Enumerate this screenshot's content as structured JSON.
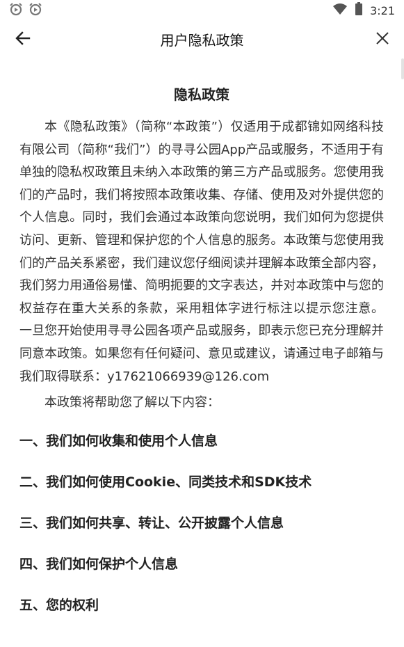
{
  "status_bar": {
    "time": "3:21",
    "icons": [
      "alarm-icon",
      "alarm-icon",
      "wifi-icon",
      "battery-icon"
    ]
  },
  "app_bar": {
    "title": "用户隐私政策",
    "back_icon": "arrow-left-icon",
    "close_icon": "close-icon"
  },
  "document": {
    "title": "隐私政策",
    "paragraph": "本《隐私政策》（简称“本政策”）仅适用于成都锦如网络科技有限公司（简称“我们”）的寻寻公园App产品或服务，不适用于有单独的隐私权政策且未纳入本政策的第三方产品或服务。您使用我们的产品时，我们将按照本政策收集、存储、使用及对外提供您的个人信息。同时，我们会通过本政策向您说明，我们如何为您提供访问、更新、管理和保护您的个人信息的服务。本政策与您使用我们的产品关系紧密，我们建议您仔细阅读并理解本政策全部内容，我们努力用通俗易懂、简明扼要的文字表达，并对本政策中与您的权益存在重大关系的条款，采用粗体字进行标注以提示您注意。 一旦您开始使用寻寻公园各项产品或服务，即表示您已充分理解并同意本政策。如果您有任何疑问、意见或建议，请通过电子邮箱与我们取得联系：y17621066939@126.com",
    "intro": "本政策将帮助您了解以下内容：",
    "sections": [
      "一、我们如何收集和使用个人信息",
      "二、我们如何使用Cookie、同类技术和SDK技术",
      "三、我们如何共享、转让、公开披露个人信息",
      "四、我们如何保护个人信息",
      "五、您的权利"
    ]
  }
}
